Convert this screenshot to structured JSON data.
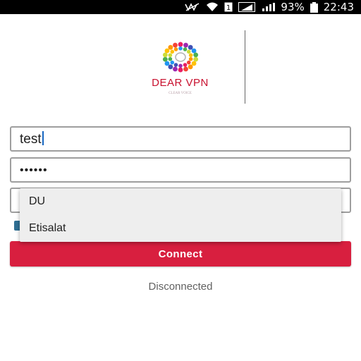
{
  "status_bar": {
    "battery_percent": "93%",
    "time": "22:43",
    "icons": [
      "mute-icon",
      "wifi-icon",
      "sim-icon",
      "signal-icon",
      "signal-icon",
      "battery-icon"
    ]
  },
  "logo": {
    "title": "DEAR VPN",
    "subtitle": "CLEAR VOICE",
    "colors": [
      "#e91e63",
      "#9c27b0",
      "#3f51b5",
      "#2196f3",
      "#4caf50",
      "#cddc39",
      "#ffc107",
      "#ff9800",
      "#f44336"
    ]
  },
  "form": {
    "username_value": "test",
    "password_value": "••••••"
  },
  "server_dropdown": {
    "options": [
      "DU",
      "Etisalat"
    ]
  },
  "connect_label": "Connect",
  "connection_status": "Disconnected",
  "colors": {
    "accent": "#d81f3f",
    "checkbox": "#2f6f93",
    "logo_text": "#c8102e"
  }
}
